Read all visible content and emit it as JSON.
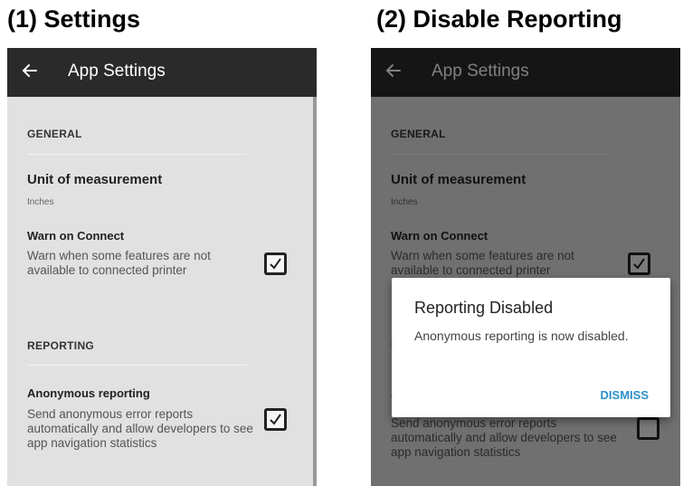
{
  "panels": [
    {
      "heading": "(1) Settings"
    },
    {
      "heading": "(2) Disable Reporting"
    }
  ],
  "appbar": {
    "title": "App Settings",
    "back_icon": "arrow-left-icon"
  },
  "general": {
    "header": "GENERAL",
    "unit": {
      "title": "Unit of measurement",
      "value": "Inches"
    },
    "warn": {
      "title": "Warn on Connect",
      "summary": "Warn when some features are not available to connected printer",
      "checked": true
    }
  },
  "reporting": {
    "header": "REPORTING",
    "anonymous": {
      "title": "Anonymous reporting",
      "summary": "Send anonymous error reports automatically and allow developers to see app navigation statistics",
      "checked": true
    }
  },
  "dialog": {
    "title": "Reporting Disabled",
    "message": "Anonymous reporting is now disabled.",
    "dismiss_label": "DISMISS"
  },
  "colors": {
    "appbar": "#2a2a2a",
    "screen_bg": "#e1e1e1",
    "accent": "#2a8fc8"
  }
}
